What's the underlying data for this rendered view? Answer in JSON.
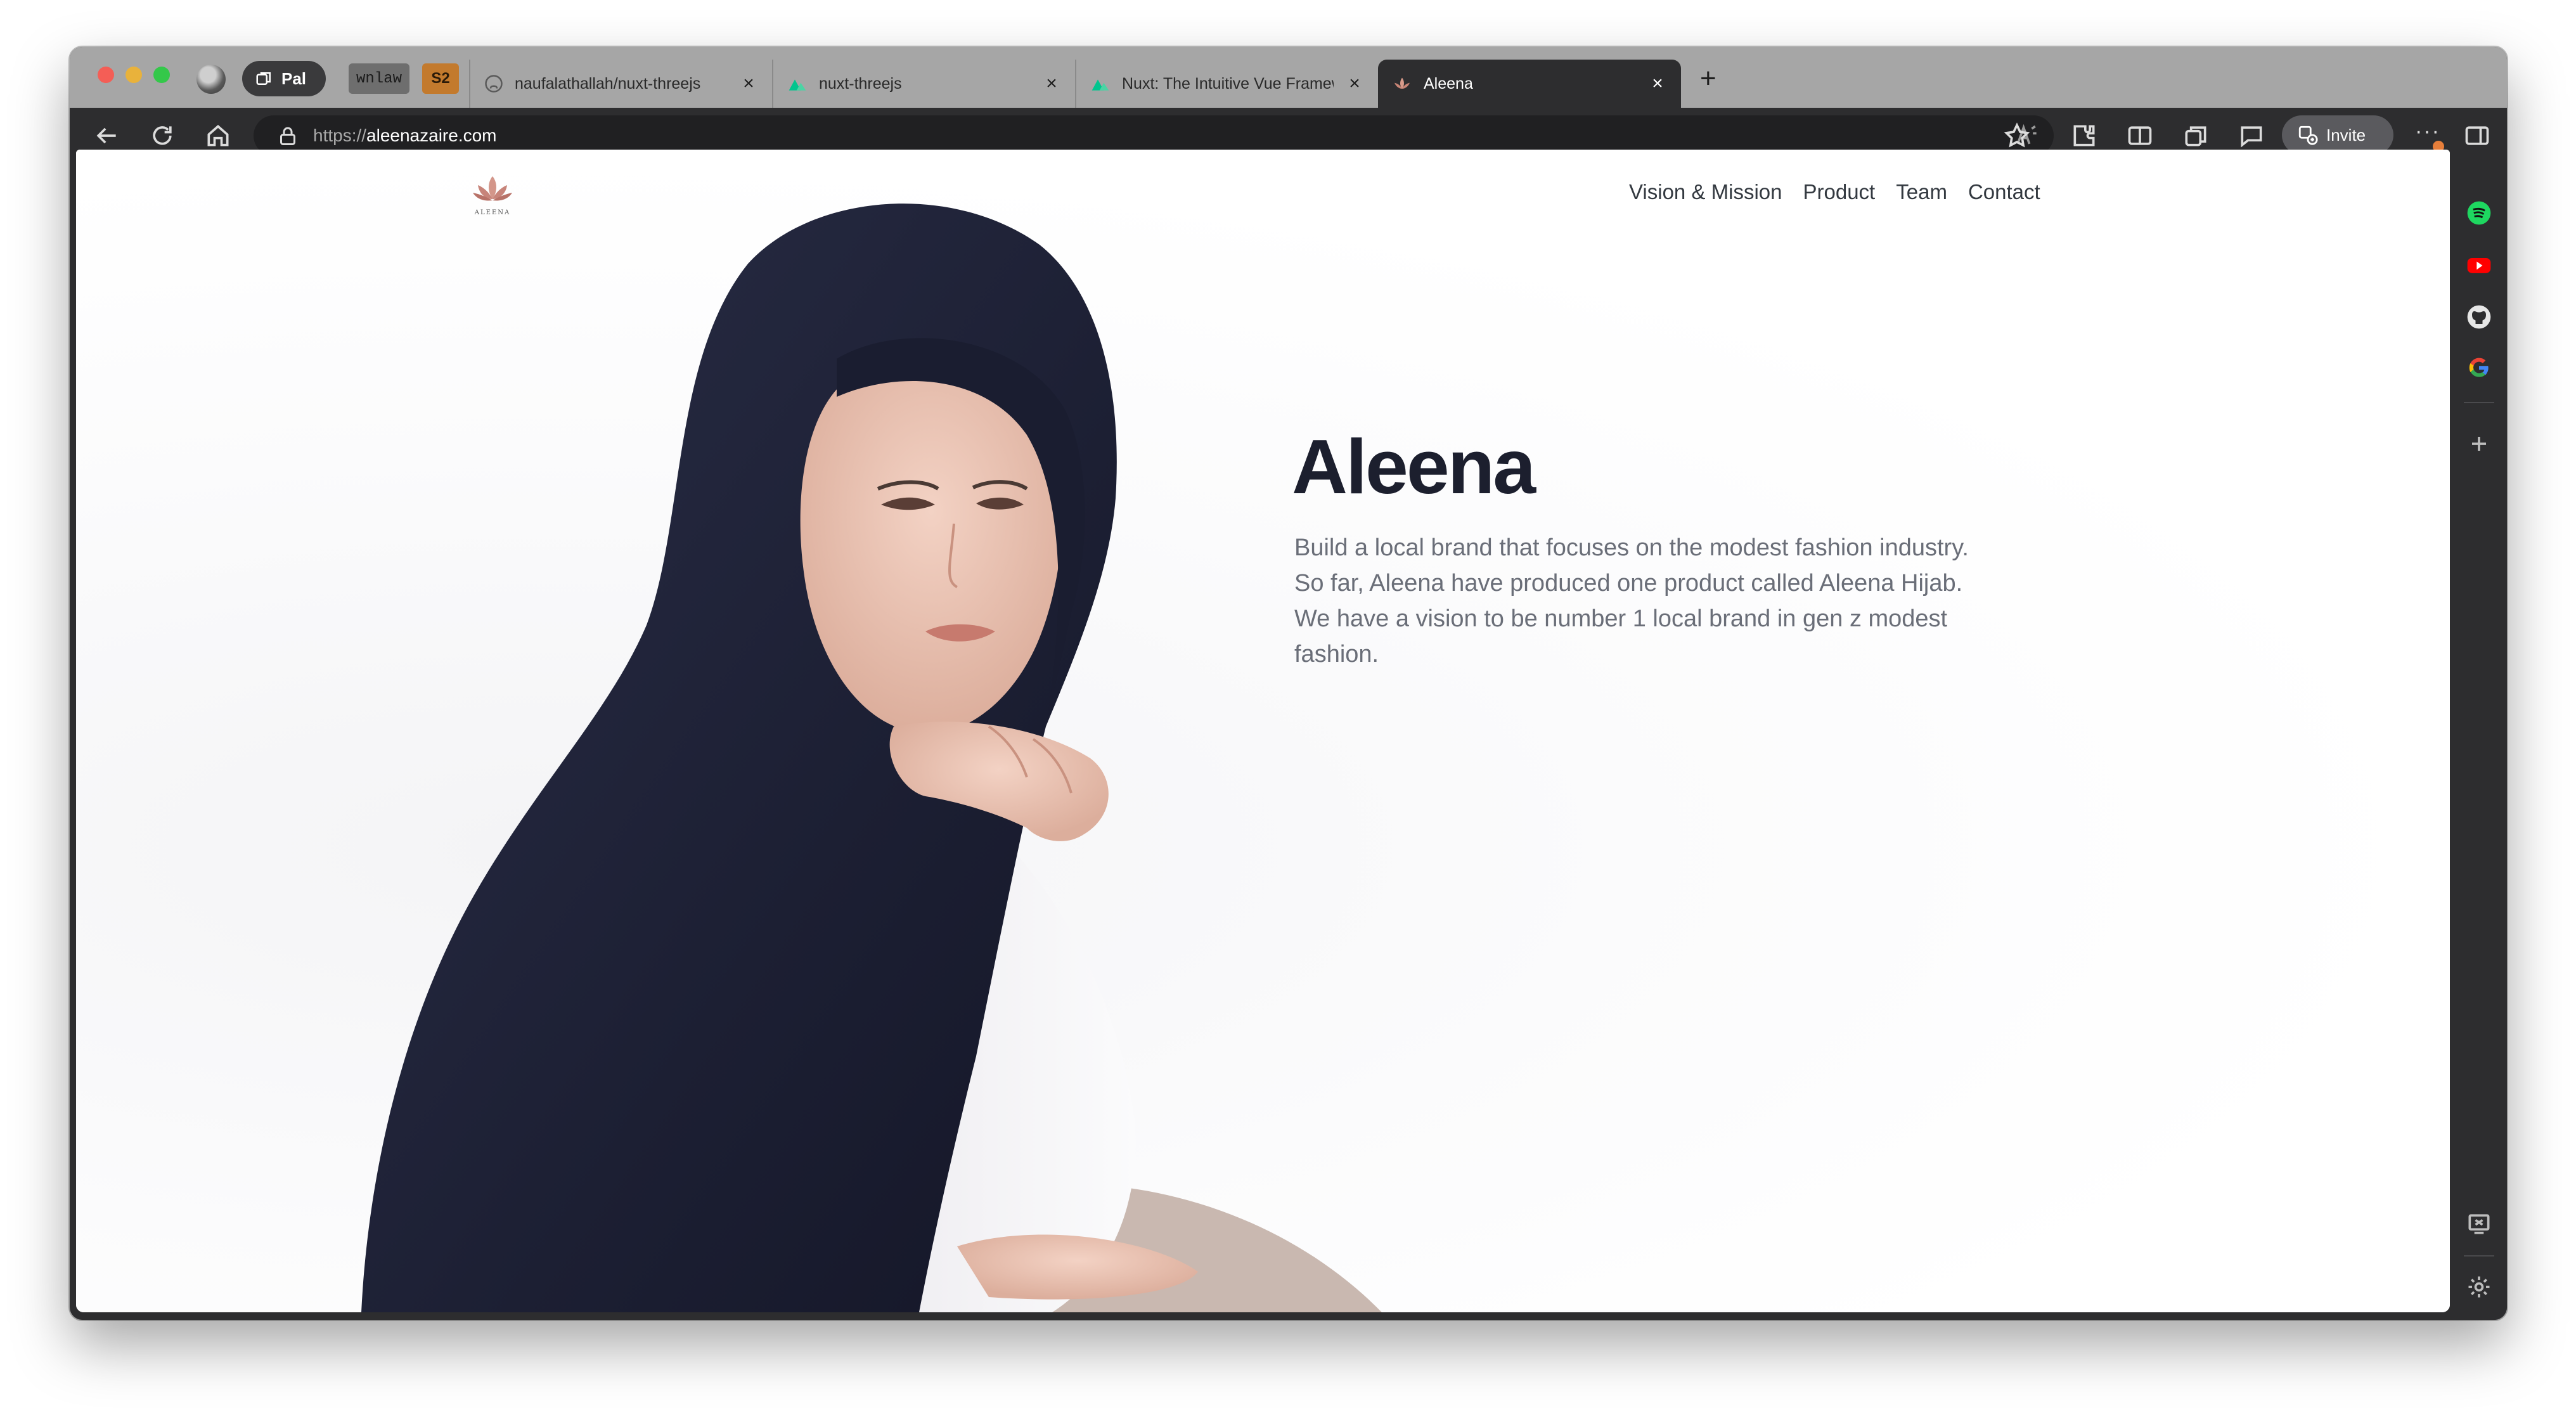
{
  "browser": {
    "workspace_label": "Pal",
    "pinned_tabs": [
      "wnlaw",
      "S2"
    ],
    "tabs": [
      {
        "title": "naufalathallah/nuxt-threejs",
        "icon": "github-icon"
      },
      {
        "title": "nuxt-threejs",
        "icon": "nuxt-icon"
      },
      {
        "title": "Nuxt: The Intuitive Vue Framew",
        "icon": "nuxt-icon"
      },
      {
        "title": "Aleena",
        "icon": "lotus-icon",
        "active": true
      }
    ],
    "address": {
      "scheme": "https://",
      "host": "aleenazaire.com"
    },
    "invite_label": "Invite",
    "more_label": "···"
  },
  "site": {
    "nav": [
      "Vision & Mission",
      "Product",
      "Team",
      "Contact"
    ],
    "hero_title": "Aleena",
    "hero_text": "Build a local brand that focuses on the modest fashion industry. So far, Aleena have produced one product called Aleena Hijab. We have a vision to be number 1 local brand in gen z modest fashion.",
    "logo_text": "ALEENA"
  },
  "colors": {
    "tab_strip": "#a6a6a6",
    "toolbar": "#2d2d2f",
    "hijab": "#1f2237",
    "title": "#1c1f2e",
    "body_text": "#6a6e78"
  }
}
